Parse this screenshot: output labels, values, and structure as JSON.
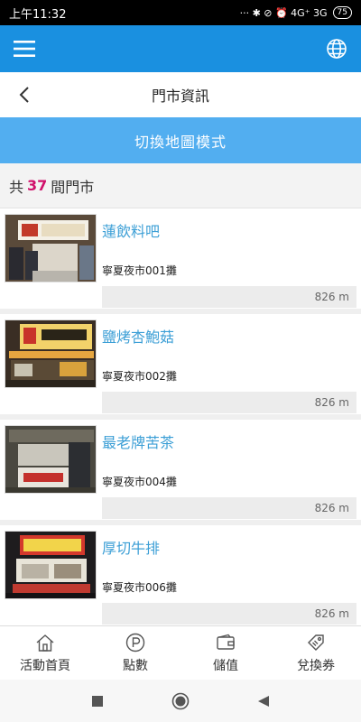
{
  "status_bar": {
    "time": "上午11:32",
    "indicators": "··· ✱ ⊘ ⏰ 4G⁺ 3G",
    "battery": "75"
  },
  "app_bar": {
    "menu_icon": "hamburger-menu-icon",
    "language_icon": "globe-icon"
  },
  "page": {
    "title": "門市資訊",
    "back_icon": "chevron-left-icon"
  },
  "map_mode_button": "切換地圖模式",
  "store_count": {
    "prefix": "共",
    "count": "37",
    "suffix": "間門市"
  },
  "stores": [
    {
      "name": "蓮飲料吧",
      "location": "寧夏夜市001攤",
      "distance": "826 m"
    },
    {
      "name": "鹽烤杏鮑菇",
      "location": "寧夏夜市002攤",
      "distance": "826 m"
    },
    {
      "name": "最老牌苦茶",
      "location": "寧夏夜市004攤",
      "distance": "826 m"
    },
    {
      "name": "厚切牛排",
      "location": "寧夏夜市006攤",
      "distance": "826 m"
    }
  ],
  "bottom_nav": [
    {
      "label": "活動首頁",
      "icon": "home-icon"
    },
    {
      "label": "點數",
      "icon": "points-icon"
    },
    {
      "label": "儲值",
      "icon": "wallet-icon"
    },
    {
      "label": "兌換券",
      "icon": "coupon-icon"
    }
  ],
  "colors": {
    "primary": "#1a90e0",
    "map_button": "#52aef0",
    "count_highlight": "#d0116b",
    "store_name": "#3c9fd6"
  }
}
